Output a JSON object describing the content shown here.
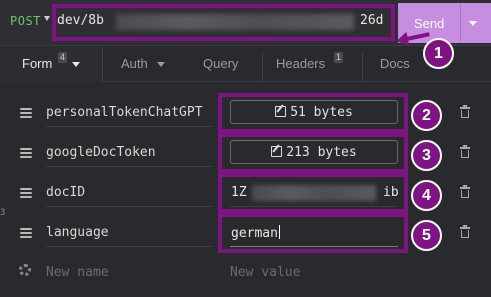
{
  "request": {
    "method": "POST",
    "url_start": "dev/8b",
    "url_end": "26d",
    "send_label": "Send"
  },
  "tabs": [
    {
      "label": "Form",
      "badge": "4"
    },
    {
      "label": "Auth"
    },
    {
      "label": "Query"
    },
    {
      "label": "Headers",
      "badge": "1"
    },
    {
      "label": "Docs"
    }
  ],
  "params": [
    {
      "name": "personalTokenChatGPT",
      "value": "51 bytes"
    },
    {
      "name": "googleDocToken",
      "value": "213 bytes"
    },
    {
      "name": "docID",
      "value_start": "1Z",
      "value_end": "ib"
    },
    {
      "name": "language",
      "value": "german"
    }
  ],
  "new_param": {
    "name_placeholder": "New name",
    "value_placeholder": "New value"
  },
  "annotations": [
    "1",
    "2",
    "3",
    "4",
    "5"
  ],
  "colors": {
    "accent": "#c78de0",
    "annotation": "#7d1481",
    "method": "#6fc36f",
    "background": "#292a2d"
  }
}
